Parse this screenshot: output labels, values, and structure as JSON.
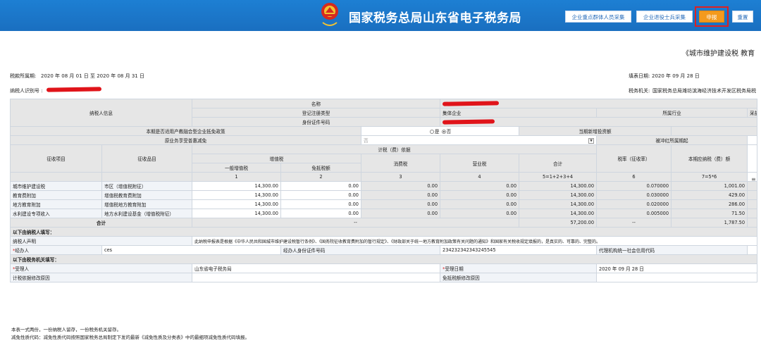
{
  "header": {
    "site_title": "国家税务总局山东省电子税务局",
    "buttons": [
      {
        "label": "企业重点群体人员采集"
      },
      {
        "label": "企业退役士兵采集"
      },
      {
        "label": "申报"
      },
      {
        "label": "重置"
      }
    ],
    "accent_color": "#f39a1d",
    "highlight_color": "#e02020"
  },
  "form": {
    "title": "《城市维护建设税 教育",
    "period_label": "税款所属期:",
    "period_value": "2020 年  08 月 01 日 至 2020 年  08 月 31 日",
    "fill_date_label": "填表日期:",
    "fill_date_value": "2020 年  09 月 28 日",
    "taxpayer_id_label": "纳税人识别号 :",
    "tax_office_label": "税务机关:",
    "tax_office_value": "国家税务总局潍坊滨海经济技术开发区税务局税"
  },
  "taxpayer_info": {
    "section_label": "纳税人信息",
    "name_label": "名称",
    "reg_type_label": "登记注册类型",
    "reg_type_value": "集体企业",
    "id_no_label": "身份证件号码",
    "industry_label": "所属行业",
    "industry_value": "采盐"
  },
  "policy": {
    "integration_label": "本期是否适用产教融合型企业抵免政策",
    "yes_label": "是",
    "no_label": "否",
    "credit_amount_label": "当期新增投资额",
    "reduction_label": "原业务享受普惠减免",
    "reduction_value": "否",
    "offset_label": "被冲红所属期起"
  },
  "columns": {
    "item": "征收项目",
    "subitem": "征收品目",
    "basis": "计税（费）依据",
    "vat": "增值税",
    "general_vat": "一般增值税",
    "exempt_vat": "免抵税额",
    "consumption": "消费税",
    "business": "营业税",
    "total": "合计",
    "rate": "税率（征收率）",
    "payable": "本期应纳税（费）额",
    "n1": "1",
    "n2": "2",
    "n3": "3",
    "n4": "4",
    "n5": "5=1+2+3+4",
    "n6": "6",
    "n7": "7=5*6"
  },
  "rows": [
    {
      "item": "城市维护建设税",
      "subitem": "市区（增值税附征）",
      "general_vat": "14,300.00",
      "exempt_vat": "0.00",
      "consumption": "0.00",
      "business": "0.00",
      "total": "14,300.00",
      "rate": "0.070000",
      "payable": "1,001.00"
    },
    {
      "item": "教育费附加",
      "subitem": "增值税教育费附加",
      "general_vat": "14,300.00",
      "exempt_vat": "0.00",
      "consumption": "0.00",
      "business": "0.00",
      "total": "14,300.00",
      "rate": "0.030000",
      "payable": "429.00"
    },
    {
      "item": "地方教育附加",
      "subitem": "增值税地方教育附加",
      "general_vat": "14,300.00",
      "exempt_vat": "0.00",
      "consumption": "0.00",
      "business": "0.00",
      "total": "14,300.00",
      "rate": "0.020000",
      "payable": "286.00"
    },
    {
      "item": "水利建设专项收入",
      "subitem": "地方水利建设基金（增值税附征）",
      "general_vat": "14,300.00",
      "exempt_vat": "0.00",
      "consumption": "0.00",
      "business": "0.00",
      "total": "14,300.00",
      "rate": "0.005000",
      "payable": "71.50"
    }
  ],
  "totals": {
    "label": "合计",
    "dash": "--",
    "total": "57,200.00",
    "rate_dash": "--",
    "payable": "1,787.50"
  },
  "taxpayer_fill": {
    "section": "以下由纳税人填写：",
    "declaration_label": "纳税人声明",
    "declaration_text": "此纳税申报表是根据《中华人民共和国城市维护建设税暂行条例》、《国务院征收教育费附加的暂行规定》、《财政部关于统一地方教育附加政策有关问题的通知》和国家有关税收规定填报的，是真实的、可靠的、完整的。",
    "agent_label": "经办人",
    "agent_value": "ces",
    "agent_id_label": "经办人身份证件号码",
    "agent_id_value": "234232342343245545",
    "agency_label": "代理机构统一社会信用代码"
  },
  "office_fill": {
    "section": "以下由税务机关填写：",
    "acceptor_label": "受理人",
    "acceptor_value": "山东省电子税务局",
    "accept_date_label": "受理日期",
    "accept_date_value": "2020 年  09 月 28 日",
    "reduction_reason_label": "计税依据修改原因",
    "exempt_reason_label": "免抵税额修改原因"
  },
  "notes": {
    "line1": "本表一式两份，一份纳税人留存，一份税务机关留存。",
    "line2": "减免性质代码：减免性质代码按照国家税务总局制定下发的最新《减免性质及分类表》中的最细项减免性质代码填报。"
  }
}
